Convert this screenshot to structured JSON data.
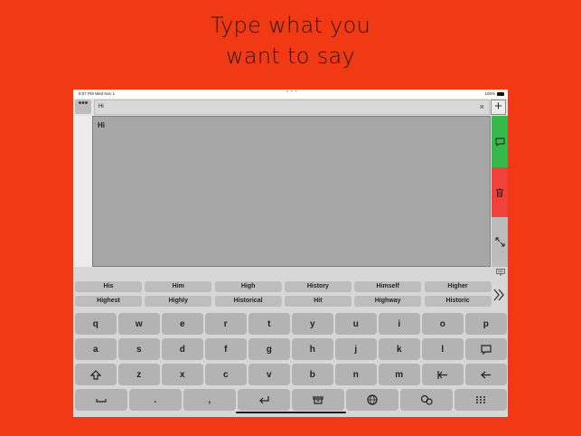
{
  "headline": {
    "line1": "Type what you",
    "line2": "want to say"
  },
  "status": {
    "time": "8:07 PM  Wed Nov 1",
    "dots": "• • •",
    "battery": "100%"
  },
  "toolbar": {
    "menu_label": "•••",
    "search_value": "Hi",
    "clear_label": "×",
    "add_label": "+"
  },
  "editor": {
    "text": "Hi"
  },
  "side_actions": [
    {
      "name": "speak",
      "icon": "speech-bubble-icon",
      "color": "#36b84b"
    },
    {
      "name": "delete",
      "icon": "trash-icon",
      "color": "#f2413b"
    },
    {
      "name": "expand",
      "icon": "expand-arrows-icon",
      "color": "#bcbcbc"
    }
  ],
  "suggestions": {
    "row1": [
      "His",
      "Him",
      "High",
      "History",
      "Himself",
      "Higher"
    ],
    "row2": [
      "Highest",
      "Highly",
      "Historical",
      "Hit",
      "Highway",
      "Historic"
    ],
    "next_icon": "double-chevron-right-icon",
    "keyboard_icon": "keyboard-icon"
  },
  "keyboard": {
    "row1": [
      "q",
      "w",
      "e",
      "r",
      "t",
      "y",
      "u",
      "i",
      "o",
      "p"
    ],
    "row2": [
      "a",
      "s",
      "d",
      "f",
      "g",
      "h",
      "j",
      "k",
      "l"
    ],
    "row3": [
      "z",
      "x",
      "c",
      "v",
      "b",
      "n",
      "m"
    ],
    "row4": [
      ".",
      ","
    ],
    "icons": [
      "shift-icon",
      "speech-bubble-icon",
      "tab-back-icon",
      "backspace-arrow-icon",
      "space-icon",
      "return-icon",
      "trash-icon",
      "globe-icon",
      "settings-icon",
      "keypad-icon"
    ]
  }
}
